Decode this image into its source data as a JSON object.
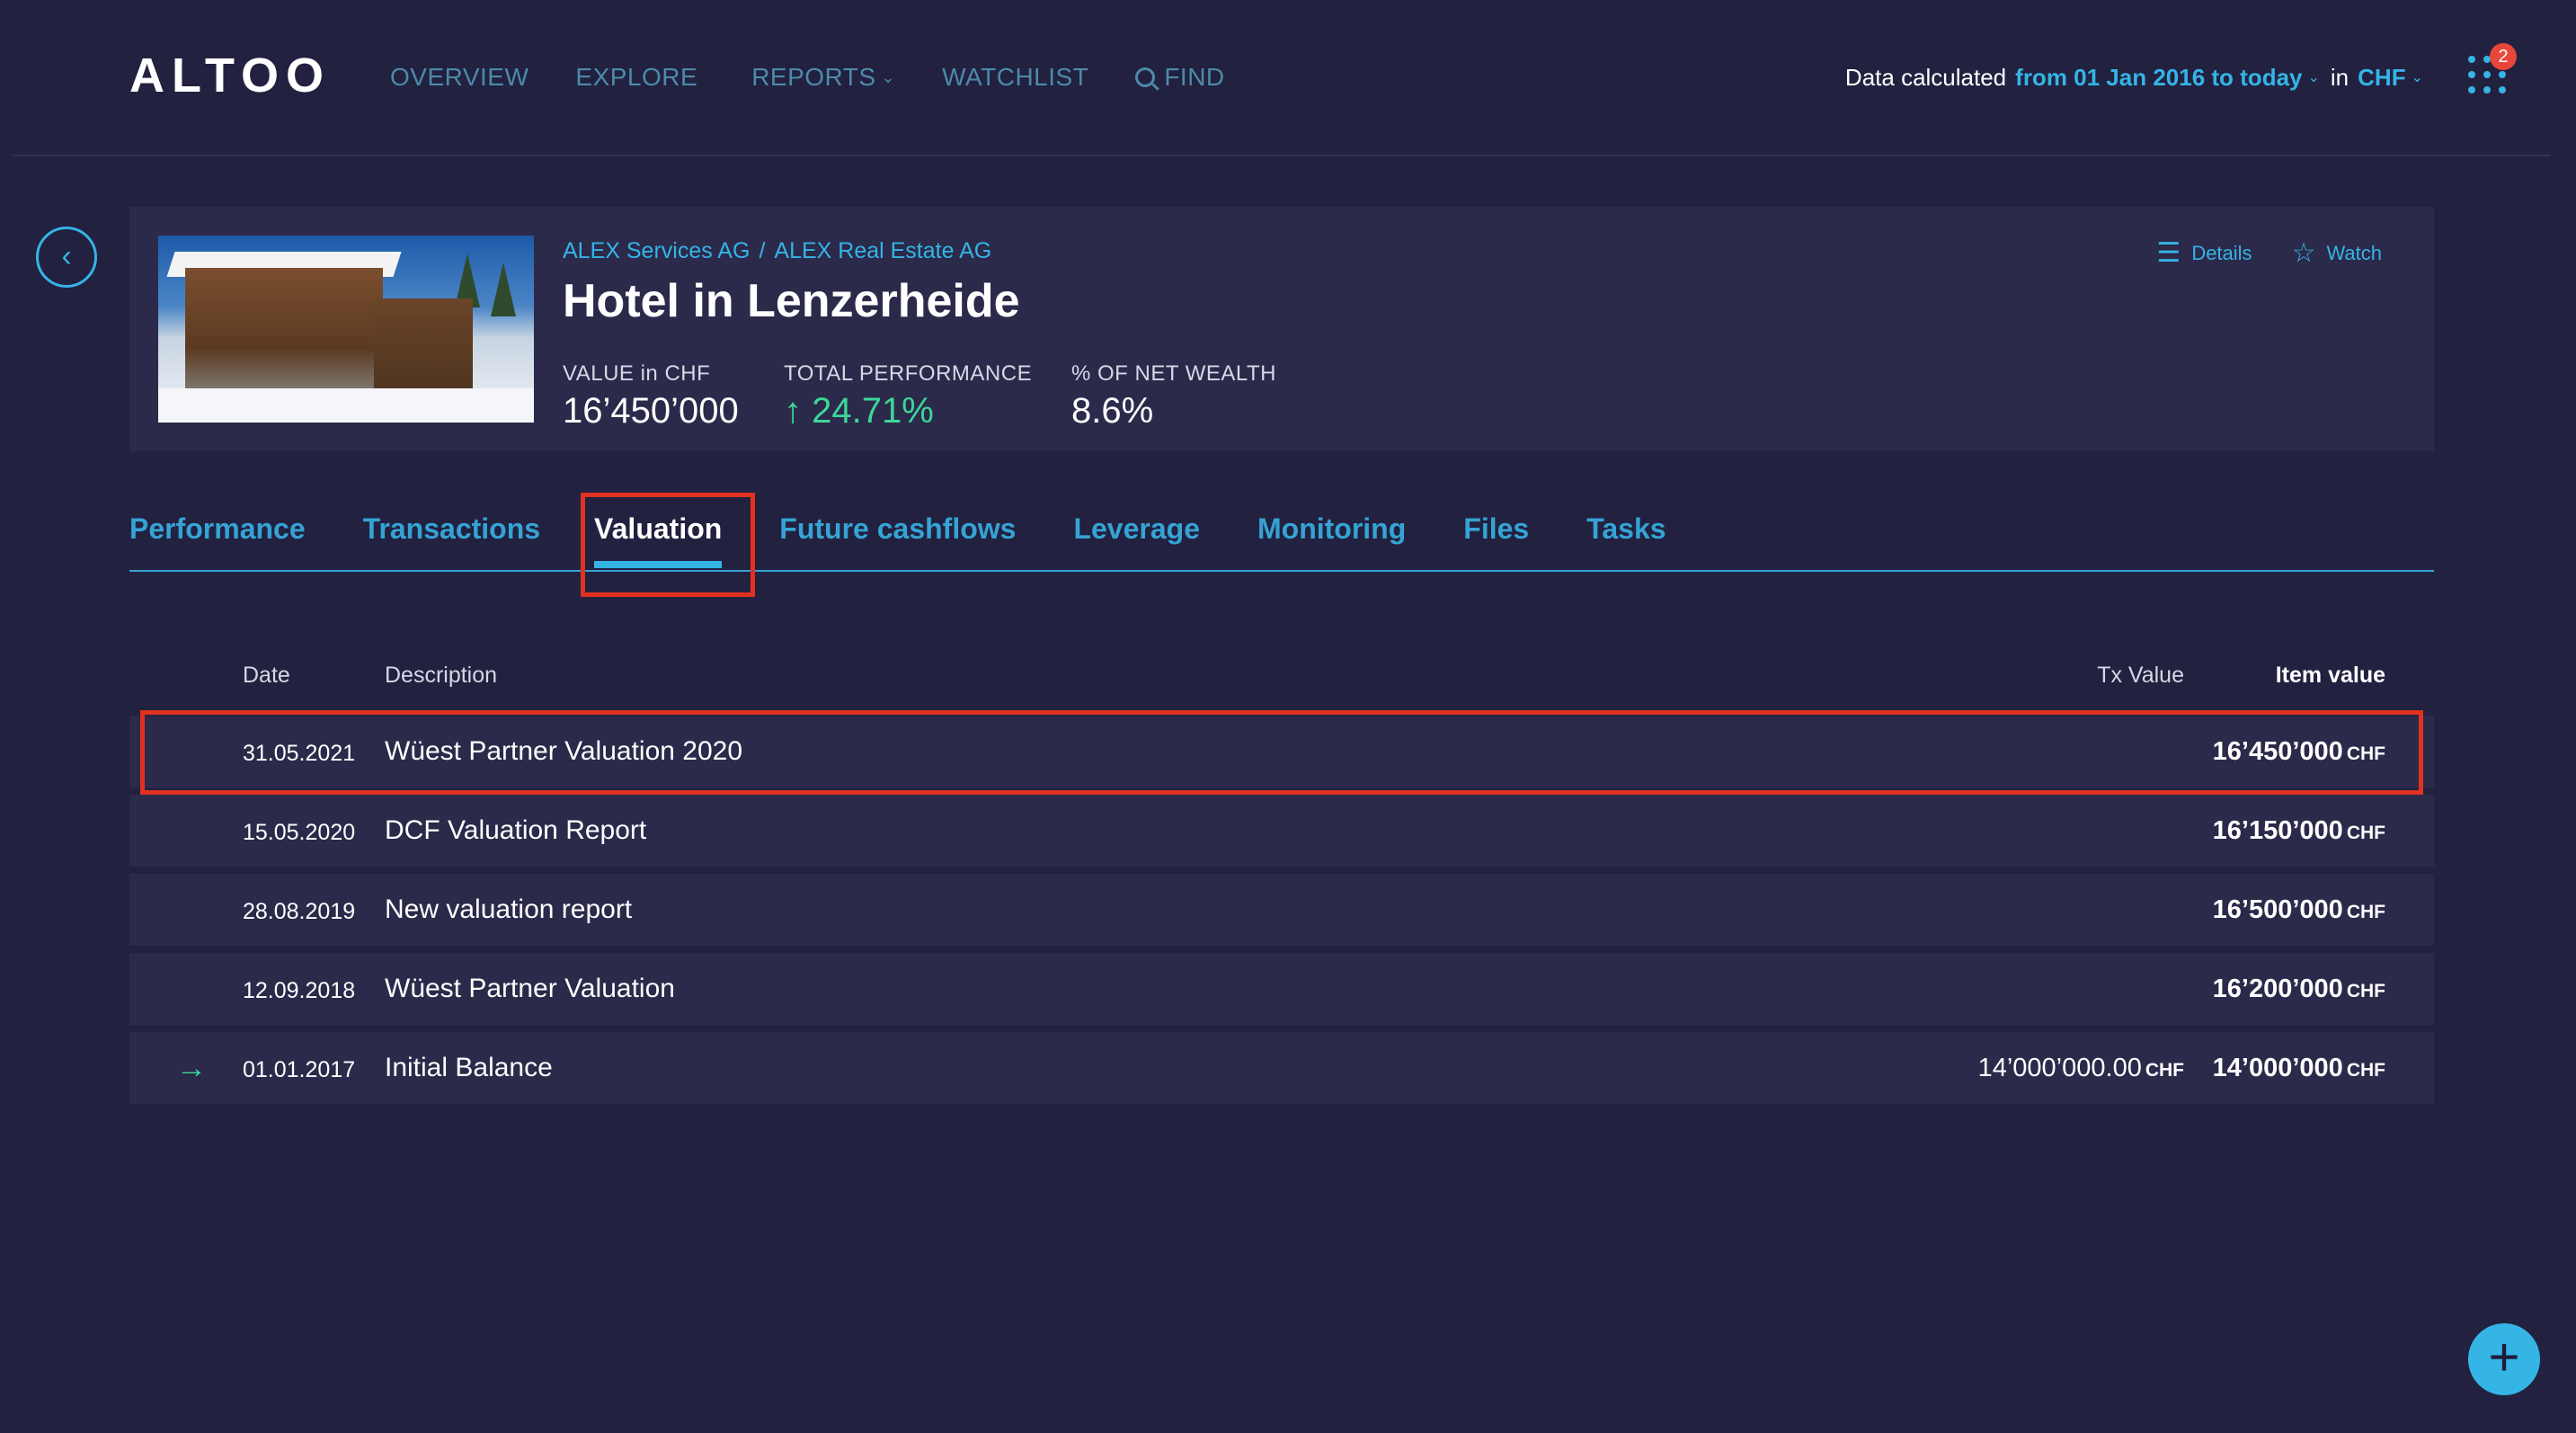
{
  "app": {
    "logo": "ALTOO"
  },
  "nav": {
    "items": [
      {
        "label": "OVERVIEW"
      },
      {
        "label": "EXPLORE"
      },
      {
        "label": "REPORTS"
      },
      {
        "label": "WATCHLIST"
      },
      {
        "label": "FIND"
      }
    ]
  },
  "calc": {
    "prefix": "Data calculated",
    "range": "from 01 Jan 2016 to today",
    "in": "in",
    "currency": "CHF"
  },
  "apps": {
    "badge": "2"
  },
  "asset": {
    "breadcrumb": [
      "ALEX Services AG",
      "ALEX Real Estate AG"
    ],
    "breadcrumb_sep": "/",
    "title": "Hotel in Lenzerheide",
    "kpis": [
      {
        "label": "VALUE in CHF",
        "value": "16’450’000"
      },
      {
        "label": "TOTAL PERFORMANCE",
        "value": "↑ 24.71%"
      },
      {
        "label": "% OF NET WEALTH",
        "value": "8.6%"
      }
    ],
    "actions": {
      "details": "Details",
      "watch": "Watch"
    }
  },
  "tabs": [
    {
      "label": "Performance"
    },
    {
      "label": "Transactions"
    },
    {
      "label": "Valuation",
      "active": true
    },
    {
      "label": "Future cashflows"
    },
    {
      "label": "Leverage"
    },
    {
      "label": "Monitoring"
    },
    {
      "label": "Files"
    },
    {
      "label": "Tasks"
    }
  ],
  "table": {
    "headers": {
      "date": "Date",
      "description": "Description",
      "tx_value": "Tx Value",
      "item_value": "Item value"
    },
    "currency": "CHF",
    "rows": [
      {
        "date": "31.05.2021",
        "description": "Wüest Partner Valuation 2020",
        "tx_value": "",
        "item_value": "16’450’000"
      },
      {
        "date": "15.05.2020",
        "description": "DCF Valuation Report",
        "tx_value": "",
        "item_value": "16’150’000"
      },
      {
        "date": "28.08.2019",
        "description": "New valuation report",
        "tx_value": "",
        "item_value": "16’500’000"
      },
      {
        "date": "12.09.2018",
        "description": "Wüest Partner Valuation",
        "tx_value": "",
        "item_value": "16’200’000"
      },
      {
        "date": "01.01.2017",
        "description": "Initial Balance",
        "tx_value": "14’000’000.00",
        "item_value": "14’000’000"
      }
    ]
  },
  "fab": {
    "label": "+"
  }
}
